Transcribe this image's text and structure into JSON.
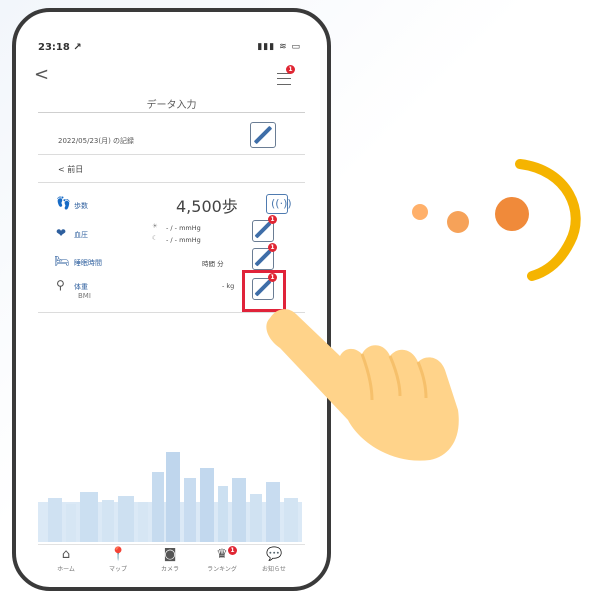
{
  "colors": {
    "accent": "#3f6ea8",
    "highlight": "#e0233a",
    "badge": "#e02633",
    "hand": "#ffd38a",
    "dots_light": "#ffb06a",
    "dots_dark": "#f08a3a",
    "arc": "#f5b400"
  },
  "status_bar": {
    "time": "23:18 ↗",
    "signal_icon": "cellular-signal-icon",
    "wifi_icon": "wifi-icon",
    "battery_icon": "battery-icon"
  },
  "nav": {
    "back_icon": "back-chevron-icon",
    "back_glyph": "<",
    "menu_icon": "hamburger-menu-icon",
    "menu_badge": "1"
  },
  "header": {
    "title": "データ入力"
  },
  "date_section": {
    "date_text": "2022/05/23(月) の記録",
    "edit_icon": "pencil-edit-icon"
  },
  "prev_day": {
    "label": "< 前日"
  },
  "rows": [
    {
      "icon": "footsteps-icon",
      "label": "歩数",
      "value": "4,500歩",
      "action_icon": "pedometer-sync-icon"
    },
    {
      "icon": "blood-pressure-icon",
      "label": "血圧",
      "morning_icon": "sun-icon",
      "morning_value": "-  /   -  mmHg",
      "night_icon": "moon-icon",
      "night_value": "-  /   -  mmHg",
      "badge": "1",
      "action_icon": "pencil-edit-icon"
    },
    {
      "icon": "sleep-bed-icon",
      "label": "睡眠時間",
      "value": "時間  分",
      "badge": "1",
      "action_icon": "pencil-edit-icon"
    },
    {
      "icon": "scale-icon",
      "label": "体重",
      "sublabel": "BMI",
      "value": "- kg",
      "badge": "1",
      "action_icon": "pencil-edit-icon"
    }
  ],
  "tabs": [
    {
      "icon": "home-icon",
      "label": "ホーム"
    },
    {
      "icon": "map-pin-icon",
      "label": "マップ"
    },
    {
      "icon": "camera-icon",
      "label": "カメラ"
    },
    {
      "icon": "crown-ranking-icon",
      "label": "ランキング",
      "badge": "1"
    },
    {
      "icon": "chat-bubble-icon",
      "label": "お知らせ"
    }
  ],
  "overlay": {
    "hand_icon": "pointing-hand-icon",
    "dots_icon": "motion-dots-icon"
  }
}
